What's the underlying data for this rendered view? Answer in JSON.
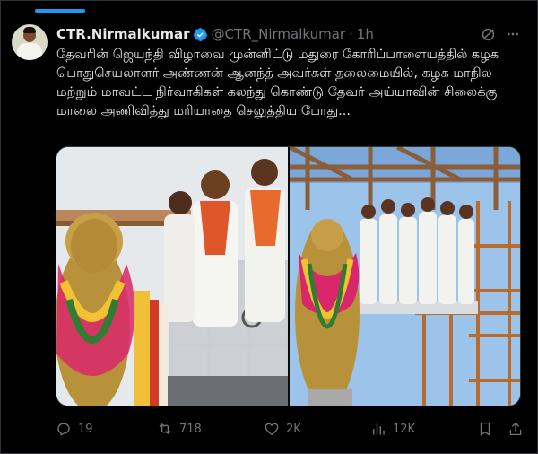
{
  "tweet": {
    "display_name": "CTR.Nirmalkumar",
    "handle": "@CTR_Nirmalkumar",
    "separator": "·",
    "time": "1h",
    "text": "தேவரின் ஜெயந்தி விழாவை முன்னிட்டு மதுரை கோரிப்பாளையத்தில் கழக பொதுசெயலாளர் அண்ணன் ஆனந்த் அவர்கள் தலைமையில், கழக மாநில மற்றும் மாவட்ட நிர்வாகிகள் கலந்து கொண்டு தேவர் அய்யாவின் சிலைக்கு மாலை அணிவித்து மரியாதை செலுத்திய போது..."
  },
  "icons": {
    "verified": "verified-badge-icon",
    "grok": "grok-icon",
    "more": "more-icon",
    "reply": "reply-icon",
    "retweet": "retweet-icon",
    "like": "heart-icon",
    "views": "views-icon",
    "bookmark": "bookmark-icon",
    "share": "share-icon"
  },
  "colors": {
    "background": "#000000",
    "text": "#e7e9ea",
    "muted": "#71767b",
    "accent": "#1d9bf0",
    "border": "#2f3336"
  },
  "stats": {
    "replies": "19",
    "retweets": "718",
    "likes": "2K",
    "views": "12K"
  }
}
